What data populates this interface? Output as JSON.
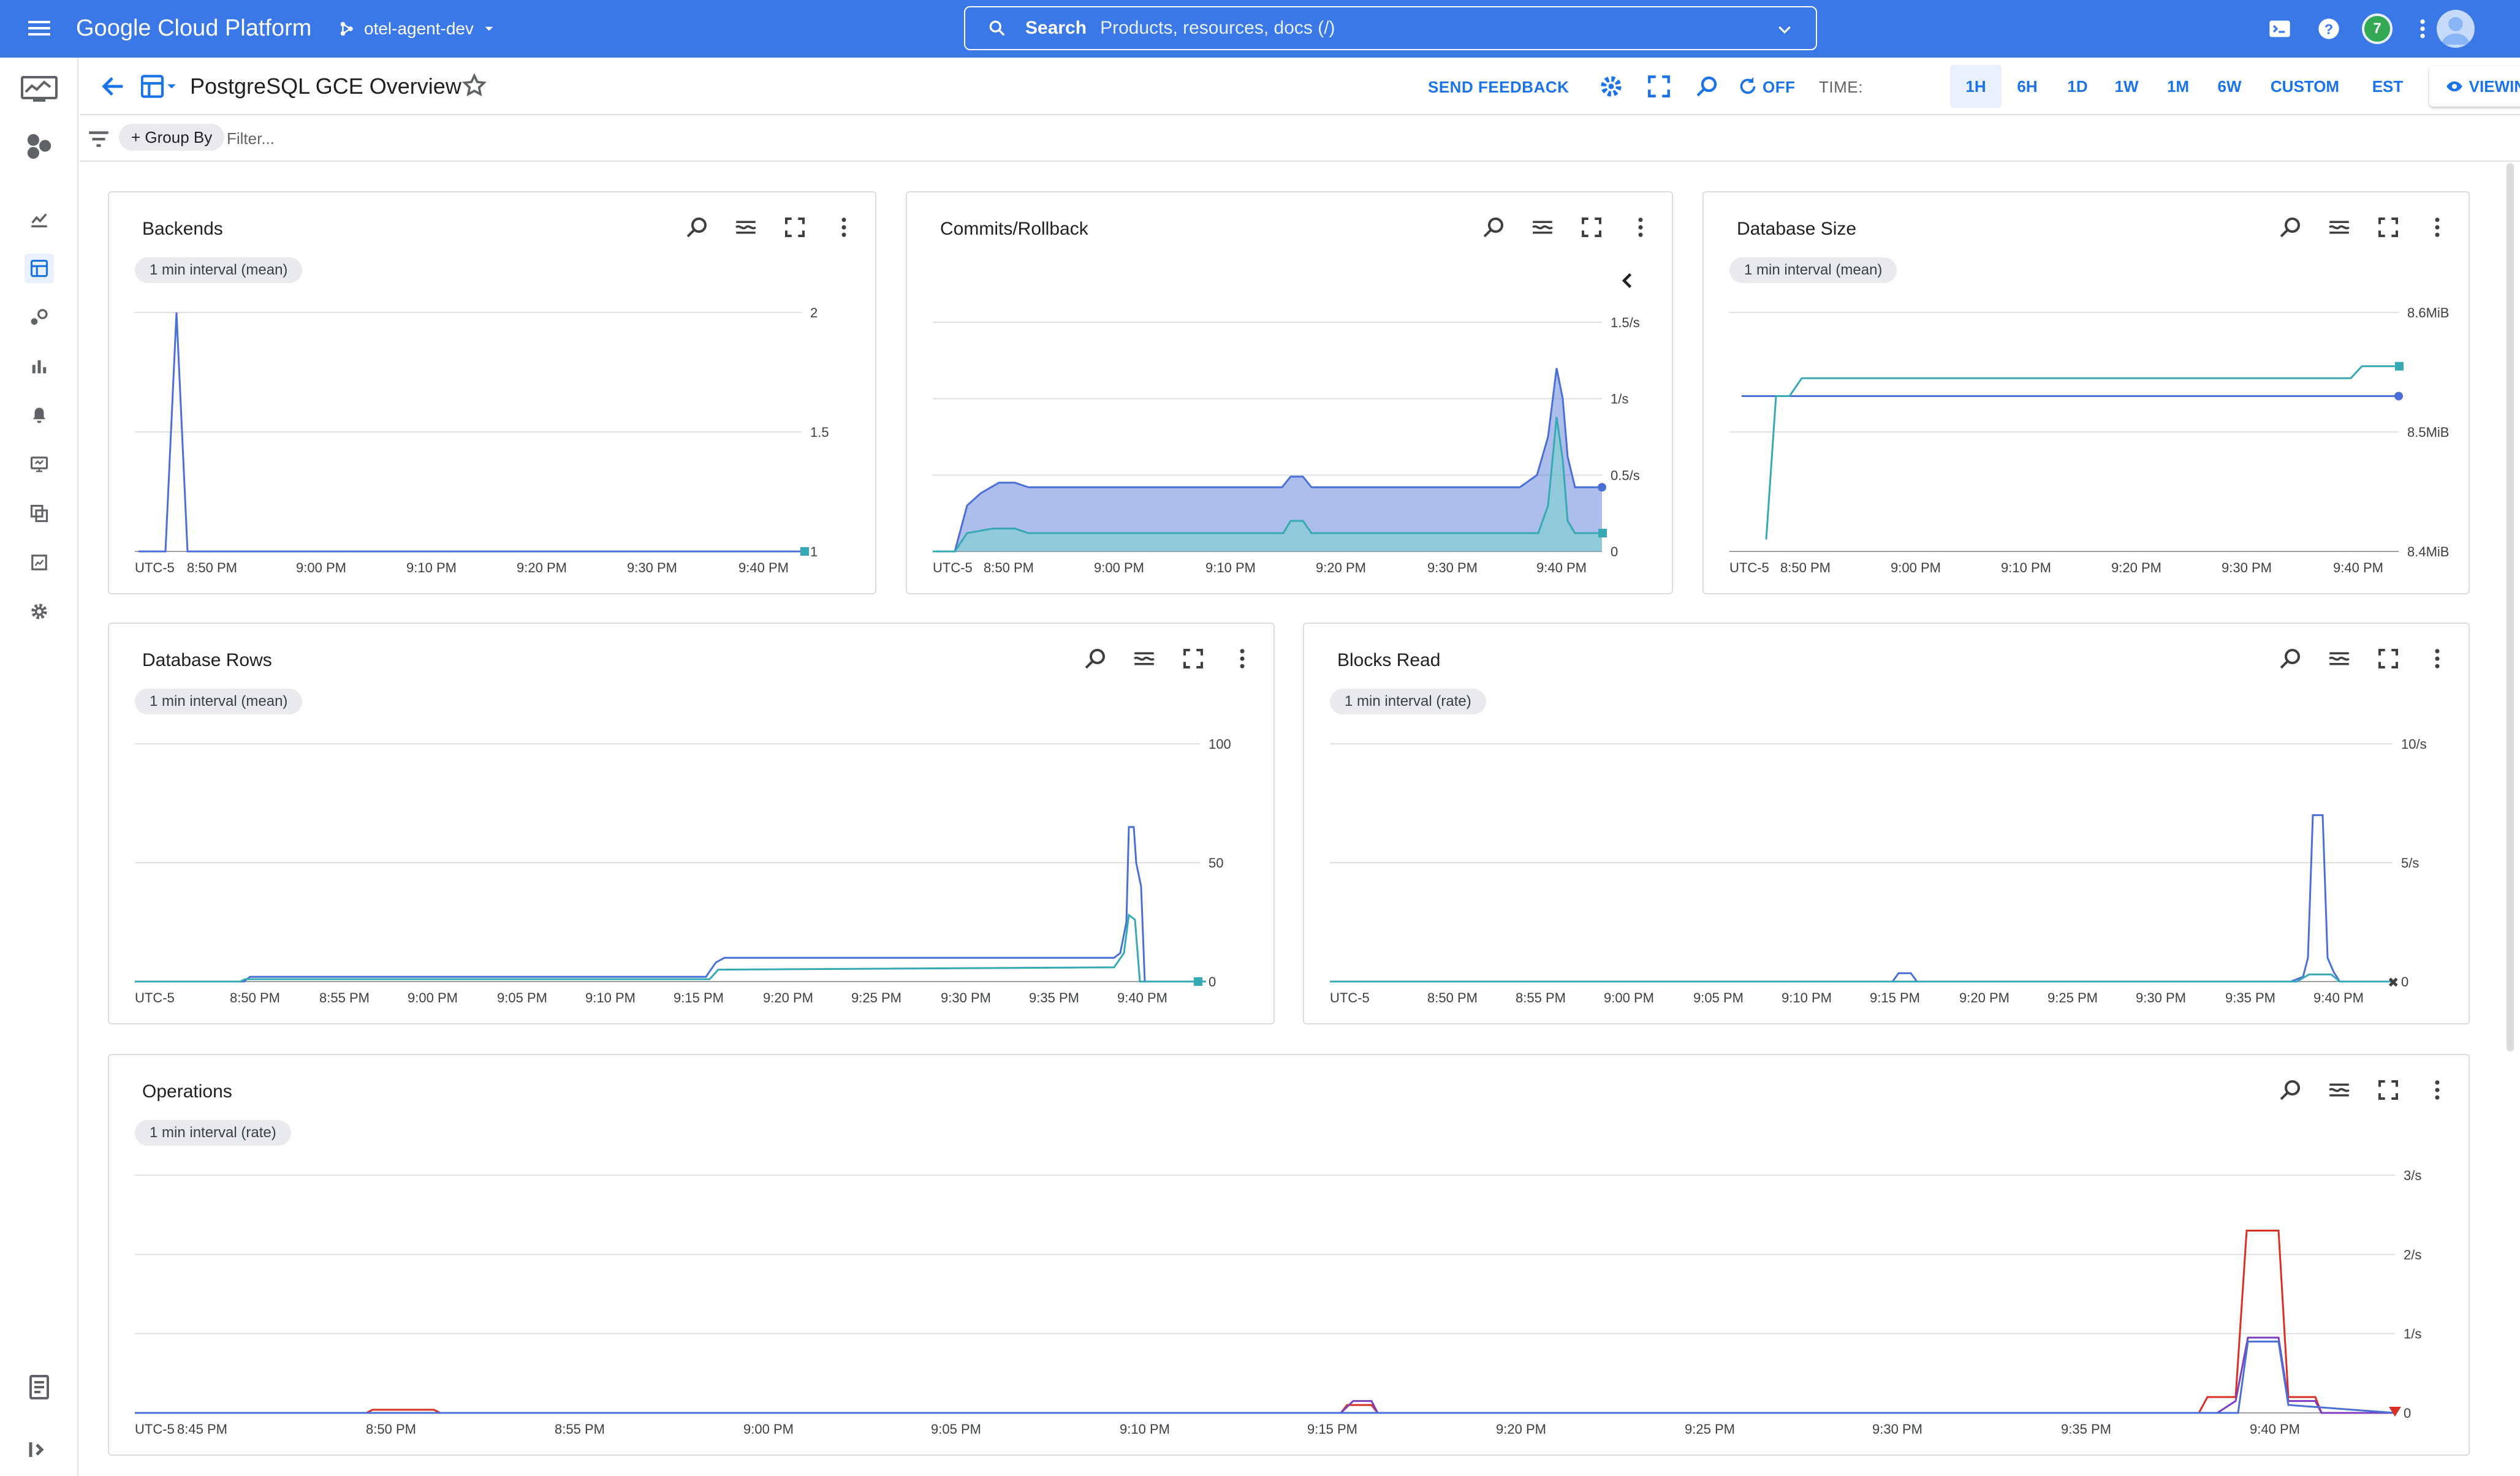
{
  "topbar": {
    "brand": "Google Cloud Platform",
    "project": "otel-agent-dev",
    "search_label": "Search",
    "search_placeholder": "Products, resources, docs (/)",
    "notification_count": "7"
  },
  "header": {
    "title": "PostgreSQL GCE Overview",
    "send_feedback": "SEND FEEDBACK",
    "auto_refresh": "OFF",
    "time_label": "TIME:",
    "time_ranges": [
      "1H",
      "6H",
      "1D",
      "1W",
      "1M",
      "6W"
    ],
    "custom": "CUSTOM",
    "timezone": "EST",
    "viewing": "VIEWING",
    "selected_range": "1H"
  },
  "filterbar": {
    "group_by": "+ Group By",
    "filter_placeholder": "Filter..."
  },
  "colors": {
    "brand_blue": "#3b78e7",
    "accent": "#1a73e8",
    "series_blue": "#4a6fd6",
    "series_teal": "#36a9b2",
    "series_red": "#d93025",
    "series_purple": "#7b3fbf"
  },
  "rail_icons": [
    "monitoring-logo-icon",
    "overview-icon",
    "metrics-explorer-icon",
    "dashboards-icon",
    "services-icon",
    "charts-icon",
    "alerting-icon",
    "uptime-icon",
    "groups-icon",
    "metrics-scope-icon",
    "settings-icon"
  ],
  "cards": {
    "backends": {
      "title": "Backends",
      "chip": "1 min interval (mean)",
      "y_ticks": [
        "2",
        "1.5",
        "1"
      ],
      "x_ticks": [
        "UTC-5",
        "8:50 PM",
        "9:00 PM",
        "9:10 PM",
        "9:20 PM",
        "9:30 PM",
        "9:40 PM"
      ]
    },
    "commits": {
      "title": "Commits/Rollback",
      "y_ticks": [
        "1.5/s",
        "1/s",
        "0.5/s",
        "0"
      ],
      "x_ticks": [
        "UTC-5",
        "8:50 PM",
        "9:00 PM",
        "9:10 PM",
        "9:20 PM",
        "9:30 PM",
        "9:40 PM"
      ]
    },
    "dbsize": {
      "title": "Database Size",
      "chip": "1 min interval (mean)",
      "y_ticks": [
        "8.6MiB",
        "8.5MiB",
        "8.4MiB"
      ],
      "x_ticks": [
        "UTC-5",
        "8:50 PM",
        "9:00 PM",
        "9:10 PM",
        "9:20 PM",
        "9:30 PM",
        "9:40 PM"
      ]
    },
    "dbrows": {
      "title": "Database Rows",
      "chip": "1 min interval (mean)",
      "y_ticks": [
        "100",
        "50",
        "0"
      ],
      "x_ticks": [
        "UTC-5",
        "8:50 PM",
        "8:55 PM",
        "9:00 PM",
        "9:05 PM",
        "9:10 PM",
        "9:15 PM",
        "9:20 PM",
        "9:25 PM",
        "9:30 PM",
        "9:35 PM",
        "9:40 PM"
      ]
    },
    "blocks": {
      "title": "Blocks Read",
      "chip": "1 min interval (rate)",
      "y_ticks": [
        "10/s",
        "5/s",
        "0"
      ],
      "x_ticks": [
        "UTC-5",
        "8:50 PM",
        "8:55 PM",
        "9:00 PM",
        "9:05 PM",
        "9:10 PM",
        "9:15 PM",
        "9:20 PM",
        "9:25 PM",
        "9:30 PM",
        "9:35 PM",
        "9:40 PM"
      ]
    },
    "ops": {
      "title": "Operations",
      "chip": "1 min interval (rate)",
      "y_ticks": [
        "3/s",
        "2/s",
        "1/s",
        "0"
      ],
      "x_ticks": [
        "UTC-5",
        "8:45 PM",
        "8:50 PM",
        "8:55 PM",
        "9:00 PM",
        "9:05 PM",
        "9:10 PM",
        "9:15 PM",
        "9:20 PM",
        "9:25 PM",
        "9:30 PM",
        "9:35 PM",
        "9:40 PM"
      ]
    }
  },
  "chart_data": [
    {
      "type": "line",
      "title": "Backends",
      "x_minutes_after_8_45pm": [
        0,
        3,
        5,
        6.5,
        63
      ],
      "series": [
        {
          "values": [
            1,
            1,
            2,
            1,
            1
          ]
        }
      ],
      "ylim": [
        1,
        2
      ]
    },
    {
      "type": "area",
      "title": "Commits/Rollback",
      "x": [
        "8:46 PM",
        "8:52 PM",
        "9:15 PM",
        "9:30 PM",
        "9:38 PM",
        "9:39 PM",
        "9:40 PM"
      ],
      "series": [
        {
          "values": [
            0,
            0.45,
            0.45,
            0.45,
            0.6,
            1.2,
            0.45
          ]
        },
        {
          "values": [
            0,
            0.15,
            0.15,
            0.15,
            0.2,
            0.9,
            0.15
          ]
        }
      ],
      "ylim": [
        0,
        1.5
      ]
    },
    {
      "type": "line",
      "title": "Database Size",
      "series": [
        {
          "values_mib": [
            8.53,
            8.53
          ]
        },
        {
          "values_mib": [
            8.41,
            8.53,
            8.55,
            8.55,
            8.56
          ]
        }
      ],
      "ylim": [
        8.4,
        8.6
      ]
    },
    {
      "type": "line",
      "title": "Database Rows",
      "x": [
        "8:48 PM",
        "9:15 PM",
        "9:37 PM",
        "9:38 PM",
        "9:39 PM",
        "9:40 PM"
      ],
      "series": [
        {
          "values": [
            2,
            10,
            10,
            65,
            40,
            0
          ]
        },
        {
          "values": [
            1,
            6,
            6,
            28,
            20,
            0
          ]
        }
      ],
      "ylim": [
        0,
        100
      ]
    },
    {
      "type": "line",
      "title": "Blocks Read",
      "x": [
        "9:16 PM",
        "9:38 PM",
        "9:39 PM",
        "9:40 PM"
      ],
      "series": [
        {
          "values": [
            0.3,
            0.2,
            7,
            0.4
          ]
        }
      ],
      "ylim": [
        0,
        10
      ]
    },
    {
      "type": "line",
      "title": "Operations",
      "x": [
        "8:50 PM",
        "9:15 PM",
        "9:38 PM",
        "9:39 PM",
        "9:40 PM",
        "9:41 PM"
      ],
      "series": [
        {
          "values": [
            0.05,
            0.1,
            0.2,
            2.3,
            2.3,
            0.2
          ]
        },
        {
          "values": [
            0.03,
            0.15,
            0.15,
            0.95,
            0.95,
            0.15
          ]
        }
      ],
      "ylim": [
        0,
        3
      ]
    }
  ]
}
